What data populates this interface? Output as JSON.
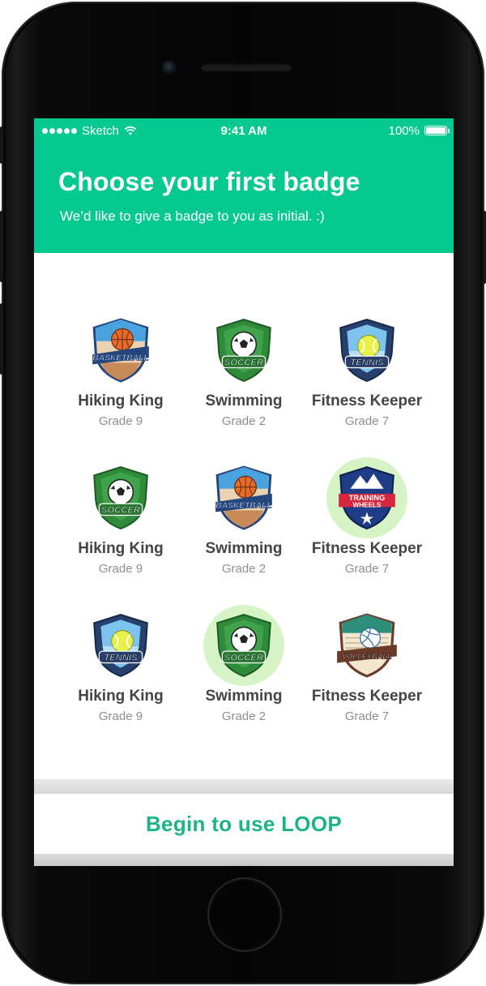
{
  "status_bar": {
    "carrier": "Sketch",
    "time": "9:41 AM",
    "battery": "100%"
  },
  "header": {
    "title": "Choose your first badge",
    "subtitle": "We’d like to give a badge to you as initial. :)"
  },
  "badges": [
    {
      "icon": "basketball-badge-icon",
      "icon_text": "BASKETBALL",
      "name": "Hiking King",
      "grade": "Grade 9",
      "selected": false
    },
    {
      "icon": "soccer-badge-icon",
      "icon_text": "SOCCER",
      "name": "Swimming",
      "grade": "Grade 2",
      "selected": false
    },
    {
      "icon": "tennis-badge-icon",
      "icon_text": "TENNIS",
      "name": "Fitness Keeper",
      "grade": "Grade 7",
      "selected": false
    },
    {
      "icon": "soccer-badge-icon",
      "icon_text": "SOCCER",
      "name": "Hiking King",
      "grade": "Grade 9",
      "selected": false
    },
    {
      "icon": "basketball-badge-icon",
      "icon_text": "BASKETBALL",
      "name": "Swimming",
      "grade": "Grade 2",
      "selected": false
    },
    {
      "icon": "training-wheels-badge-icon",
      "icon_text": "TRAINING WHEELS",
      "name": "Fitness Keeper",
      "grade": "Grade 7",
      "selected": true
    },
    {
      "icon": "tennis-badge-icon",
      "icon_text": "TENNIS",
      "name": "Hiking King",
      "grade": "Grade 9",
      "selected": false
    },
    {
      "icon": "soccer-badge-icon",
      "icon_text": "SOCCER",
      "name": "Swimming",
      "grade": "Grade 2",
      "selected": true
    },
    {
      "icon": "volleyball-badge-icon",
      "icon_text": "VOLLEYBALL",
      "name": "Fitness Keeper",
      "grade": "Grade 7",
      "selected": false
    }
  ],
  "cta": {
    "label": "Begin to use LOOP"
  },
  "colors": {
    "accent": "#06c990",
    "cta_text": "#1bb585",
    "selected_bg": "#d7f4c6"
  }
}
